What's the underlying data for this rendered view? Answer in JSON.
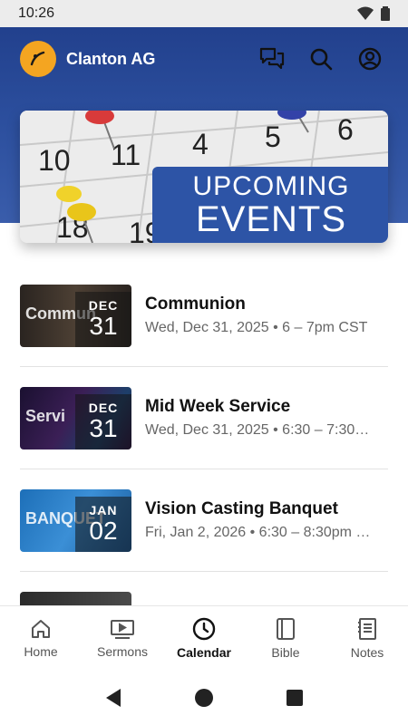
{
  "status_bar": {
    "time": "10:26"
  },
  "header": {
    "church_name": "Clanton AG"
  },
  "banner": {
    "line1": "UPCOMING",
    "line2": "EVENTS"
  },
  "events": [
    {
      "title": "Communion",
      "subtitle": "Wed, Dec 31, 2025 • 6 – 7pm CST",
      "month": "DEC",
      "day": "31",
      "thumb_text": "Commun"
    },
    {
      "title": "Mid Week Service",
      "subtitle": "Wed, Dec 31, 2025 • 6:30 – 7:30…",
      "month": "DEC",
      "day": "31",
      "thumb_text": "Servi"
    },
    {
      "title": "Vision Casting Banquet",
      "subtitle": "Fri, Jan 2, 2026 • 6:30 – 8:30pm …",
      "month": "JAN",
      "day": "02",
      "thumb_text": "BANQUET"
    },
    {
      "title": "",
      "subtitle": "",
      "month": "",
      "day": "",
      "thumb_text": ""
    }
  ],
  "bottom_nav": [
    {
      "label": "Home",
      "icon": "home-icon"
    },
    {
      "label": "Sermons",
      "icon": "video-icon"
    },
    {
      "label": "Calendar",
      "icon": "clock-icon",
      "active": true
    },
    {
      "label": "Bible",
      "icon": "book-icon"
    },
    {
      "label": "Notes",
      "icon": "notes-icon"
    }
  ],
  "colors": {
    "header_blue": "#1f3c88",
    "logo_orange": "#f4a521",
    "banner_tag_blue": "#2d54a6"
  }
}
